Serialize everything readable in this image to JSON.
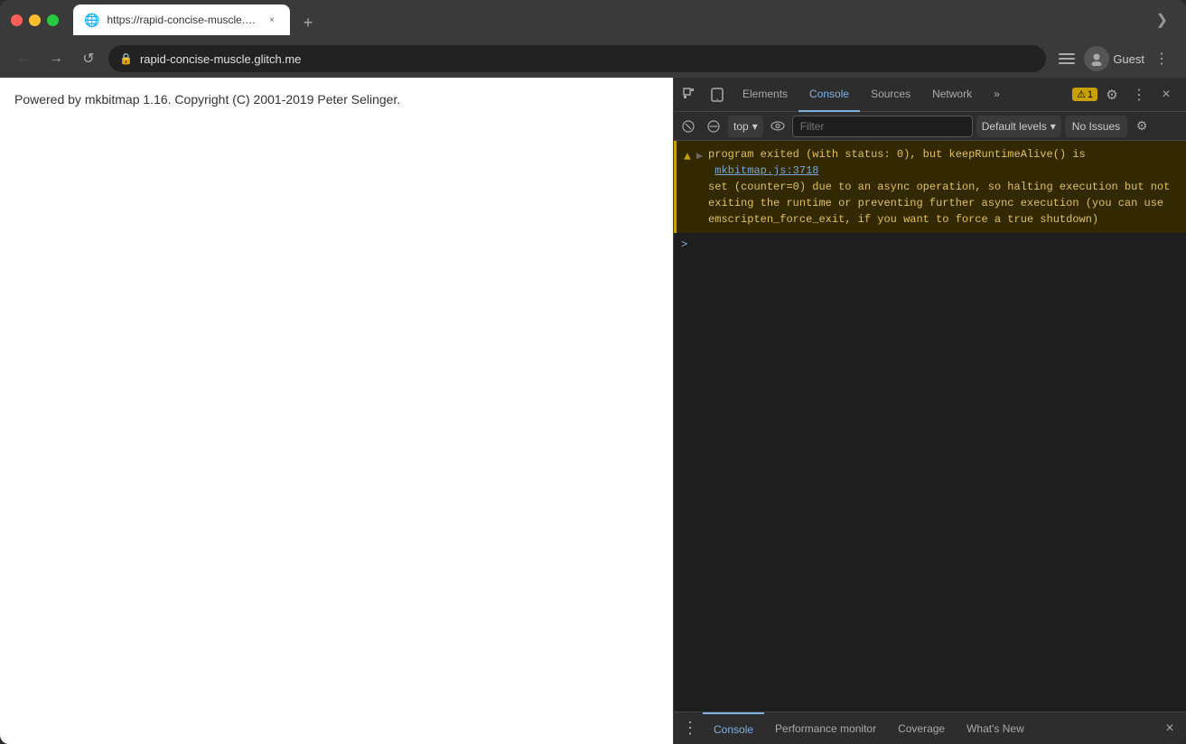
{
  "browser": {
    "traffic_lights": [
      "close",
      "minimize",
      "maximize"
    ],
    "tab": {
      "favicon": "🌐",
      "title": "https://rapid-concise-muscle.g...",
      "close_label": "×"
    },
    "new_tab_label": "+",
    "expand_label": "❯"
  },
  "navbar": {
    "back_label": "←",
    "forward_label": "→",
    "reload_label": "↺",
    "address": "rapid-concise-muscle.glitch.me",
    "lock_icon": "🔒",
    "customize_icon": "⊞",
    "profile_label": "Guest",
    "more_icon": "⋮"
  },
  "webpage": {
    "content": "Powered by mkbitmap 1.16. Copyright (C) 2001-2019 Peter Selinger."
  },
  "devtools": {
    "toolbar": {
      "inspect_icon": "⬚",
      "device_icon": "📱",
      "tabs": [
        "Elements",
        "Console",
        "Sources",
        "Network"
      ],
      "active_tab": "Console",
      "more_tabs_icon": "»",
      "warning_count": "1",
      "warning_icon": "⚠",
      "settings_icon": "⚙",
      "more_icon": "⋮",
      "close_icon": "×"
    },
    "toolbar2": {
      "error_icon": "⊘",
      "block_icon": "⊘",
      "context": "top",
      "eye_icon": "👁",
      "filter_placeholder": "Filter",
      "levels_label": "Default levels",
      "levels_chevron": "▾",
      "no_issues_label": "No Issues",
      "settings_icon": "⚙"
    },
    "console": {
      "warning_message": "▶ program exited (with status: 0), but keepRuntimeAlive() is  mkbitmap.js:3718\n set (counter=0) due to an async operation, so halting execution but not\n exiting the runtime or preventing further async execution (you can use\n emscripten_force_exit, if you want to force a true shutdown)",
      "warning_link_text": "mkbitmap.js:3718",
      "prompt_symbol": ">"
    },
    "bottom_bar": {
      "dots_icon": "⋮",
      "tabs": [
        "Console",
        "Performance monitor",
        "Coverage",
        "What's New"
      ],
      "active_tab": "Console",
      "close_icon": "×"
    }
  }
}
